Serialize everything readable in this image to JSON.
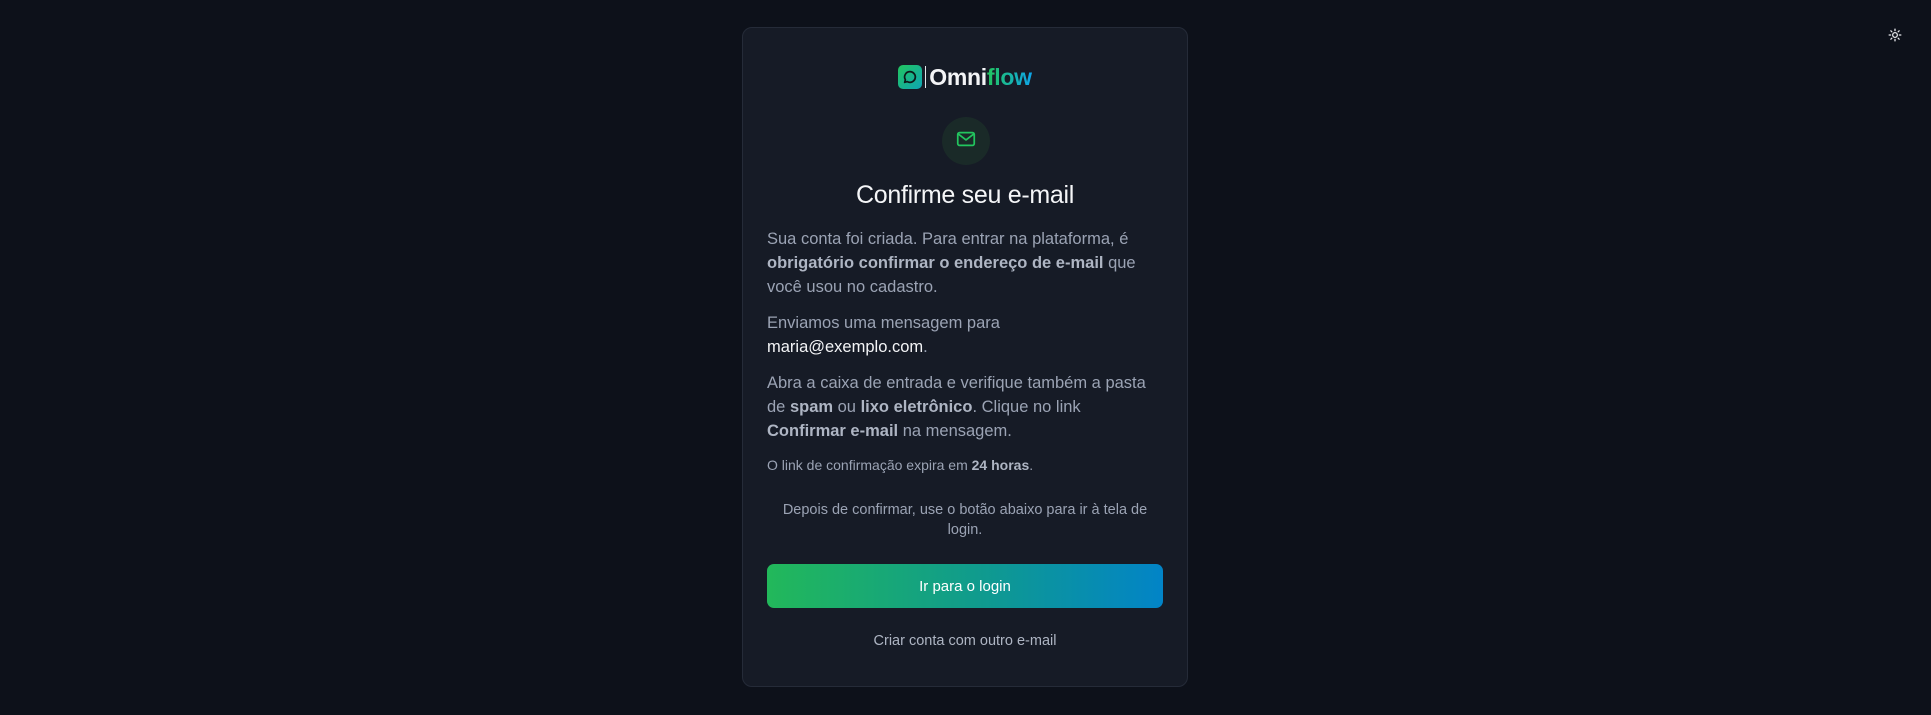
{
  "header": {
    "theme_toggle_icon": "sun-icon"
  },
  "brand": {
    "logo_icon": "chat-bubble-icon",
    "name_part1": "Omni",
    "name_part2": "flow",
    "accent_start": "#22c55e",
    "accent_end": "#0ea5e9"
  },
  "card": {
    "status_icon": "mail-icon",
    "title": "Confirme seu e-mail",
    "p1_a": "Sua conta foi criada. Para entrar na plataforma, é ",
    "p1_b": "obrigatório confirmar o endereço de e-mail",
    "p1_c": " que você usou no cadastro.",
    "p2_a": "Enviamos uma mensagem para ",
    "p2_email": "maria@exemplo.com",
    "p2_c": ".",
    "p3_a": "Abra a caixa de entrada e verifique também a pasta de ",
    "p3_b": "spam",
    "p3_c": " ou ",
    "p3_d": "lixo eletrônico",
    "p3_e": ". Clique no link ",
    "p3_f": "Confirmar e-mail",
    "p3_g": " na mensagem.",
    "p4_a": "O link de confirmação expira em ",
    "p4_b": "24 horas",
    "p4_c": ".",
    "note": "Depois de confirmar, use o botão abaixo para ir à tela de login.",
    "login_button": "Ir para o login",
    "alt_link": "Criar conta com outro e-mail"
  }
}
